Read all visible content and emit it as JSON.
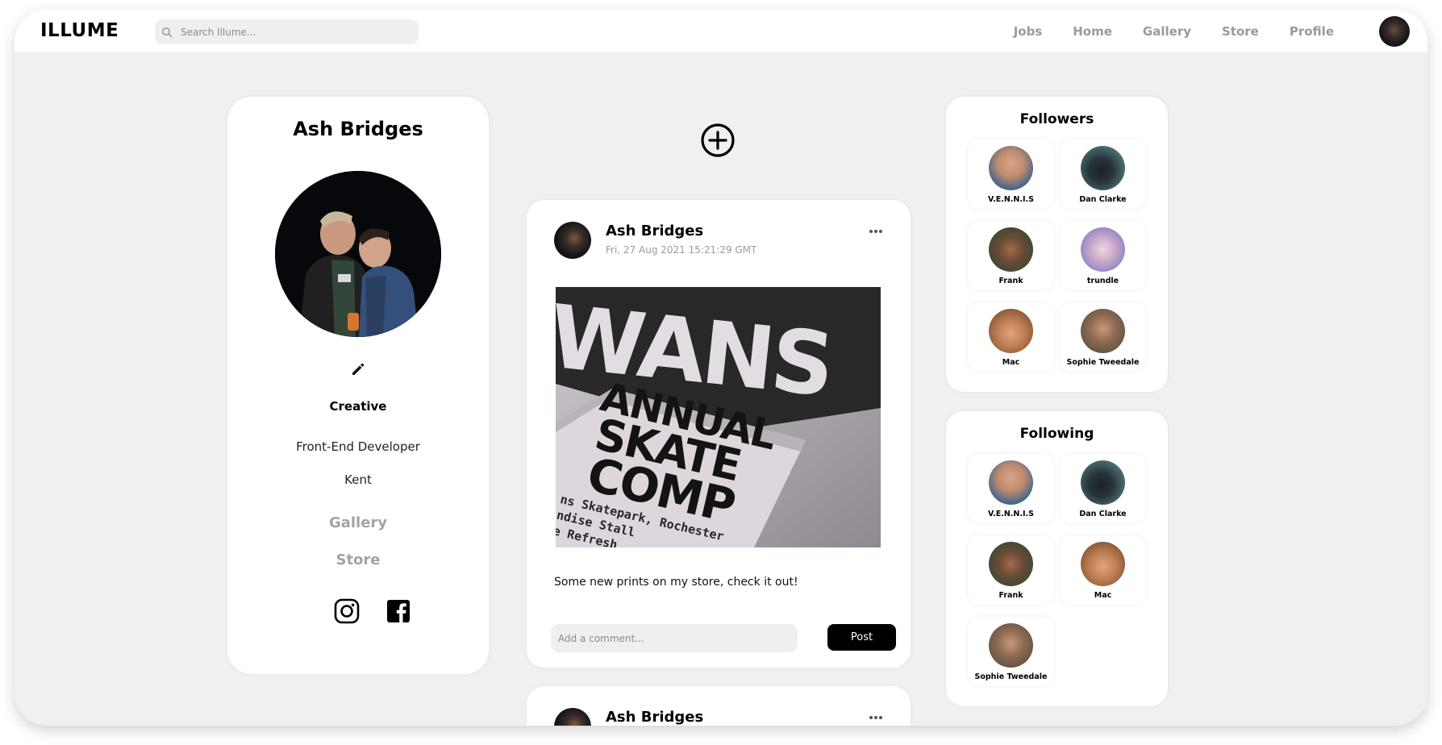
{
  "app": {
    "logo": "ILLUME"
  },
  "search": {
    "placeholder": "Search Illume..."
  },
  "nav": {
    "links": [
      "Jobs",
      "Home",
      "Gallery",
      "Store",
      "Profile"
    ]
  },
  "profile": {
    "name": "Ash Bridges",
    "type": "Creative",
    "role": "Front-End Developer",
    "location": "Kent",
    "links": {
      "gallery": "Gallery",
      "store": "Store"
    }
  },
  "posts": [
    {
      "author": "Ash Bridges",
      "date": "Fri, 27 Aug 2021 15:21:29 GMT",
      "caption": "Some new prints on my store, check it out!",
      "comment_placeholder": "Add a comment...",
      "post_label": "Post",
      "image_text": {
        "top": "WANS",
        "l1": "ANNUAL",
        "l2": "SKATE",
        "l3": "COMP",
        "small1": "ns Skatepark, Rochester",
        "small2": "ndise Stall",
        "small3": "e Refresh"
      }
    },
    {
      "author": "Ash Bridges"
    }
  ],
  "followers": {
    "title": "Followers",
    "people": [
      "V.E.N.N.I.S",
      "Dan Clarke",
      "Frank",
      "trundle",
      "Mac",
      "Sophie Tweedale"
    ]
  },
  "following": {
    "title": "Following",
    "people": [
      "V.E.N.N.I.S",
      "Dan Clarke",
      "Frank",
      "Mac",
      "Sophie Tweedale"
    ]
  },
  "colors": {
    "page_bg": "#f0f0f0",
    "card_bg": "#ffffff",
    "text_primary": "#000000",
    "text_muted": "#9a9a9a",
    "button_bg": "#000000"
  }
}
